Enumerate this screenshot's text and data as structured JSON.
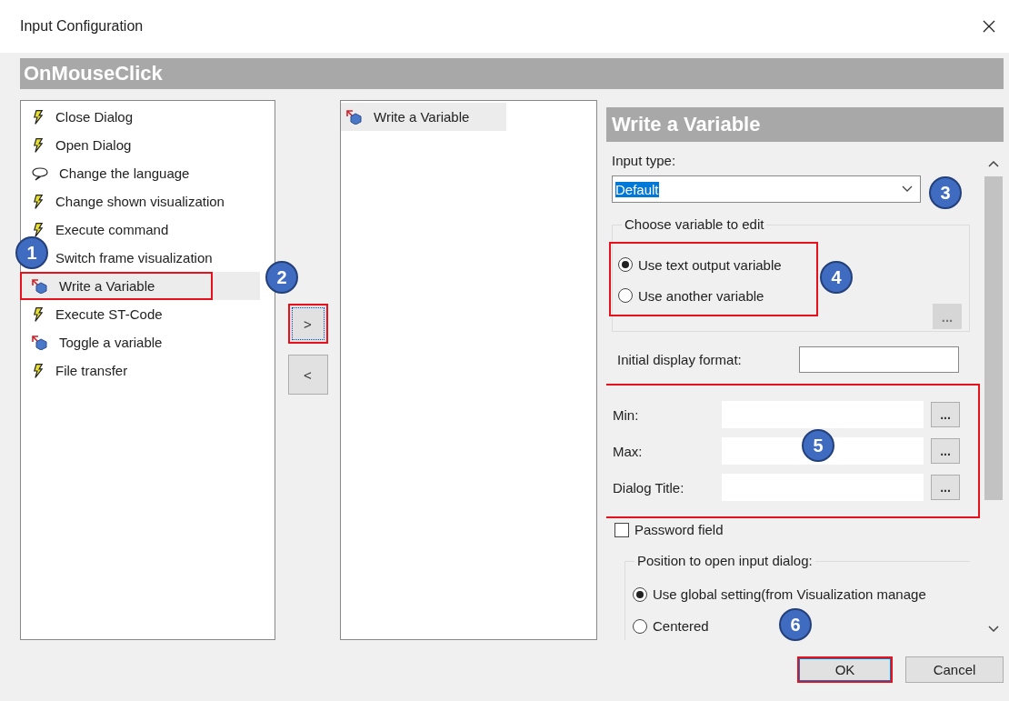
{
  "window": {
    "title": "Input Configuration"
  },
  "event_header": "OnMouseClick",
  "actions": [
    {
      "label": "Close Dialog",
      "kind": "lightning",
      "selected": false,
      "highlighted": false
    },
    {
      "label": "Open Dialog",
      "kind": "lightning",
      "selected": false,
      "highlighted": false
    },
    {
      "label": "Change the language",
      "kind": "speech",
      "selected": false,
      "highlighted": false
    },
    {
      "label": "Change shown visualization",
      "kind": "lightning",
      "selected": false,
      "highlighted": false
    },
    {
      "label": "Execute command",
      "kind": "lightning",
      "selected": false,
      "highlighted": false
    },
    {
      "label": "Switch frame visualization",
      "selected": false,
      "highlighted": false
    },
    {
      "label": "Write a Variable",
      "kind": "variable",
      "selected": true,
      "highlighted": true
    },
    {
      "label": "Execute ST-Code",
      "kind": "lightning",
      "selected": false,
      "highlighted": false
    },
    {
      "label": "Toggle a variable",
      "kind": "variable",
      "selected": false,
      "highlighted": false
    },
    {
      "label": "File transfer",
      "kind": "lightning",
      "selected": false,
      "highlighted": false
    }
  ],
  "move_buttons": [
    {
      "label": ">",
      "highlighted": true
    },
    {
      "label": "<",
      "highlighted": false
    }
  ],
  "assigned": [
    {
      "label": "Write a Variable",
      "kind": "variable",
      "selected": true
    }
  ],
  "detail": {
    "title": "Write a Variable",
    "input_type_label": "Input type:",
    "input_type_value": "Default",
    "variable_group": {
      "title": "Choose variable to edit",
      "highlighted": true,
      "options": [
        {
          "label": "Use text output variable",
          "selected": true
        },
        {
          "label": "Use another variable",
          "selected": false
        }
      ],
      "browse_button": "...",
      "browse_disabled": true
    },
    "format_label": "Initial display format:",
    "fields_highlighted": true,
    "fields": [
      {
        "label": "Min:",
        "button": "..."
      },
      {
        "label": "Max:",
        "button": "..."
      },
      {
        "label": "Dialog Title:",
        "button": "..."
      }
    ],
    "password": {
      "label": "Password field",
      "checked": false
    },
    "position_group": {
      "title": "Position to open input dialog:",
      "options": [
        {
          "label": "Use global setting(from Visualization manage",
          "selected": true
        },
        {
          "label": "Centered",
          "selected": false
        }
      ]
    }
  },
  "buttons": [
    {
      "label": "OK",
      "highlighted": true
    },
    {
      "label": "Cancel",
      "highlighted": false
    }
  ],
  "callouts": [
    "1",
    "2",
    "3",
    "4",
    "5",
    "6"
  ]
}
